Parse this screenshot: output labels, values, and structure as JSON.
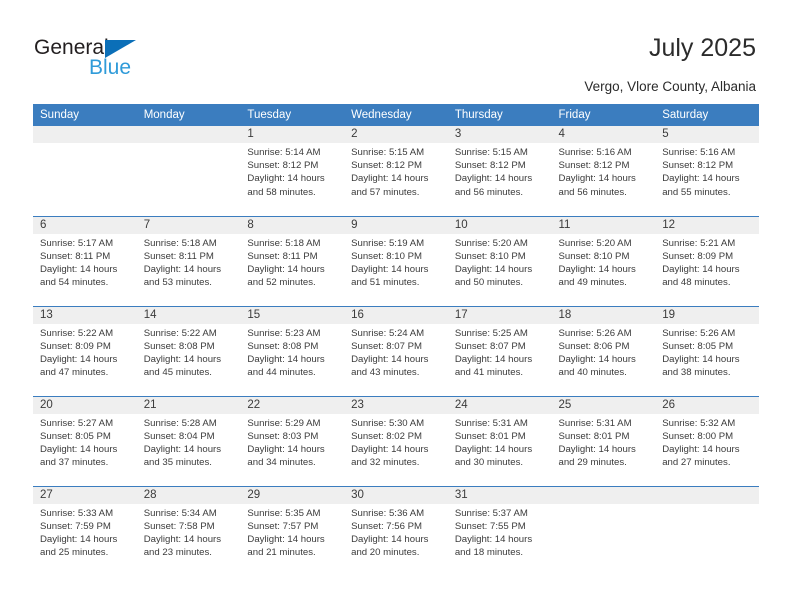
{
  "brand": {
    "name_part1": "General",
    "name_part2": "Blue",
    "accent_color": "#0b6fb8",
    "accent_color_light": "#2f9bd9"
  },
  "header": {
    "title": "July 2025",
    "subtitle": "Vergo, Vlore County, Albania",
    "header_bg": "#3b7dbf",
    "daynum_bg": "#efefef"
  },
  "weekdays": [
    "Sunday",
    "Monday",
    "Tuesday",
    "Wednesday",
    "Thursday",
    "Friday",
    "Saturday"
  ],
  "weeks": [
    [
      {
        "day": "",
        "sunrise": "",
        "sunset": "",
        "daylight1": "",
        "daylight2": "",
        "empty": true
      },
      {
        "day": "",
        "sunrise": "",
        "sunset": "",
        "daylight1": "",
        "daylight2": "",
        "empty": true
      },
      {
        "day": "1",
        "sunrise": "Sunrise: 5:14 AM",
        "sunset": "Sunset: 8:12 PM",
        "daylight1": "Daylight: 14 hours",
        "daylight2": "and 58 minutes."
      },
      {
        "day": "2",
        "sunrise": "Sunrise: 5:15 AM",
        "sunset": "Sunset: 8:12 PM",
        "daylight1": "Daylight: 14 hours",
        "daylight2": "and 57 minutes."
      },
      {
        "day": "3",
        "sunrise": "Sunrise: 5:15 AM",
        "sunset": "Sunset: 8:12 PM",
        "daylight1": "Daylight: 14 hours",
        "daylight2": "and 56 minutes."
      },
      {
        "day": "4",
        "sunrise": "Sunrise: 5:16 AM",
        "sunset": "Sunset: 8:12 PM",
        "daylight1": "Daylight: 14 hours",
        "daylight2": "and 56 minutes."
      },
      {
        "day": "5",
        "sunrise": "Sunrise: 5:16 AM",
        "sunset": "Sunset: 8:12 PM",
        "daylight1": "Daylight: 14 hours",
        "daylight2": "and 55 minutes."
      }
    ],
    [
      {
        "day": "6",
        "sunrise": "Sunrise: 5:17 AM",
        "sunset": "Sunset: 8:11 PM",
        "daylight1": "Daylight: 14 hours",
        "daylight2": "and 54 minutes."
      },
      {
        "day": "7",
        "sunrise": "Sunrise: 5:18 AM",
        "sunset": "Sunset: 8:11 PM",
        "daylight1": "Daylight: 14 hours",
        "daylight2": "and 53 minutes."
      },
      {
        "day": "8",
        "sunrise": "Sunrise: 5:18 AM",
        "sunset": "Sunset: 8:11 PM",
        "daylight1": "Daylight: 14 hours",
        "daylight2": "and 52 minutes."
      },
      {
        "day": "9",
        "sunrise": "Sunrise: 5:19 AM",
        "sunset": "Sunset: 8:10 PM",
        "daylight1": "Daylight: 14 hours",
        "daylight2": "and 51 minutes."
      },
      {
        "day": "10",
        "sunrise": "Sunrise: 5:20 AM",
        "sunset": "Sunset: 8:10 PM",
        "daylight1": "Daylight: 14 hours",
        "daylight2": "and 50 minutes."
      },
      {
        "day": "11",
        "sunrise": "Sunrise: 5:20 AM",
        "sunset": "Sunset: 8:10 PM",
        "daylight1": "Daylight: 14 hours",
        "daylight2": "and 49 minutes."
      },
      {
        "day": "12",
        "sunrise": "Sunrise: 5:21 AM",
        "sunset": "Sunset: 8:09 PM",
        "daylight1": "Daylight: 14 hours",
        "daylight2": "and 48 minutes."
      }
    ],
    [
      {
        "day": "13",
        "sunrise": "Sunrise: 5:22 AM",
        "sunset": "Sunset: 8:09 PM",
        "daylight1": "Daylight: 14 hours",
        "daylight2": "and 47 minutes."
      },
      {
        "day": "14",
        "sunrise": "Sunrise: 5:22 AM",
        "sunset": "Sunset: 8:08 PM",
        "daylight1": "Daylight: 14 hours",
        "daylight2": "and 45 minutes."
      },
      {
        "day": "15",
        "sunrise": "Sunrise: 5:23 AM",
        "sunset": "Sunset: 8:08 PM",
        "daylight1": "Daylight: 14 hours",
        "daylight2": "and 44 minutes."
      },
      {
        "day": "16",
        "sunrise": "Sunrise: 5:24 AM",
        "sunset": "Sunset: 8:07 PM",
        "daylight1": "Daylight: 14 hours",
        "daylight2": "and 43 minutes."
      },
      {
        "day": "17",
        "sunrise": "Sunrise: 5:25 AM",
        "sunset": "Sunset: 8:07 PM",
        "daylight1": "Daylight: 14 hours",
        "daylight2": "and 41 minutes."
      },
      {
        "day": "18",
        "sunrise": "Sunrise: 5:26 AM",
        "sunset": "Sunset: 8:06 PM",
        "daylight1": "Daylight: 14 hours",
        "daylight2": "and 40 minutes."
      },
      {
        "day": "19",
        "sunrise": "Sunrise: 5:26 AM",
        "sunset": "Sunset: 8:05 PM",
        "daylight1": "Daylight: 14 hours",
        "daylight2": "and 38 minutes."
      }
    ],
    [
      {
        "day": "20",
        "sunrise": "Sunrise: 5:27 AM",
        "sunset": "Sunset: 8:05 PM",
        "daylight1": "Daylight: 14 hours",
        "daylight2": "and 37 minutes."
      },
      {
        "day": "21",
        "sunrise": "Sunrise: 5:28 AM",
        "sunset": "Sunset: 8:04 PM",
        "daylight1": "Daylight: 14 hours",
        "daylight2": "and 35 minutes."
      },
      {
        "day": "22",
        "sunrise": "Sunrise: 5:29 AM",
        "sunset": "Sunset: 8:03 PM",
        "daylight1": "Daylight: 14 hours",
        "daylight2": "and 34 minutes."
      },
      {
        "day": "23",
        "sunrise": "Sunrise: 5:30 AM",
        "sunset": "Sunset: 8:02 PM",
        "daylight1": "Daylight: 14 hours",
        "daylight2": "and 32 minutes."
      },
      {
        "day": "24",
        "sunrise": "Sunrise: 5:31 AM",
        "sunset": "Sunset: 8:01 PM",
        "daylight1": "Daylight: 14 hours",
        "daylight2": "and 30 minutes."
      },
      {
        "day": "25",
        "sunrise": "Sunrise: 5:31 AM",
        "sunset": "Sunset: 8:01 PM",
        "daylight1": "Daylight: 14 hours",
        "daylight2": "and 29 minutes."
      },
      {
        "day": "26",
        "sunrise": "Sunrise: 5:32 AM",
        "sunset": "Sunset: 8:00 PM",
        "daylight1": "Daylight: 14 hours",
        "daylight2": "and 27 minutes."
      }
    ],
    [
      {
        "day": "27",
        "sunrise": "Sunrise: 5:33 AM",
        "sunset": "Sunset: 7:59 PM",
        "daylight1": "Daylight: 14 hours",
        "daylight2": "and 25 minutes."
      },
      {
        "day": "28",
        "sunrise": "Sunrise: 5:34 AM",
        "sunset": "Sunset: 7:58 PM",
        "daylight1": "Daylight: 14 hours",
        "daylight2": "and 23 minutes."
      },
      {
        "day": "29",
        "sunrise": "Sunrise: 5:35 AM",
        "sunset": "Sunset: 7:57 PM",
        "daylight1": "Daylight: 14 hours",
        "daylight2": "and 21 minutes."
      },
      {
        "day": "30",
        "sunrise": "Sunrise: 5:36 AM",
        "sunset": "Sunset: 7:56 PM",
        "daylight1": "Daylight: 14 hours",
        "daylight2": "and 20 minutes."
      },
      {
        "day": "31",
        "sunrise": "Sunrise: 5:37 AM",
        "sunset": "Sunset: 7:55 PM",
        "daylight1": "Daylight: 14 hours",
        "daylight2": "and 18 minutes."
      },
      {
        "day": "",
        "sunrise": "",
        "sunset": "",
        "daylight1": "",
        "daylight2": "",
        "empty": true
      },
      {
        "day": "",
        "sunrise": "",
        "sunset": "",
        "daylight1": "",
        "daylight2": "",
        "empty": true
      }
    ]
  ]
}
